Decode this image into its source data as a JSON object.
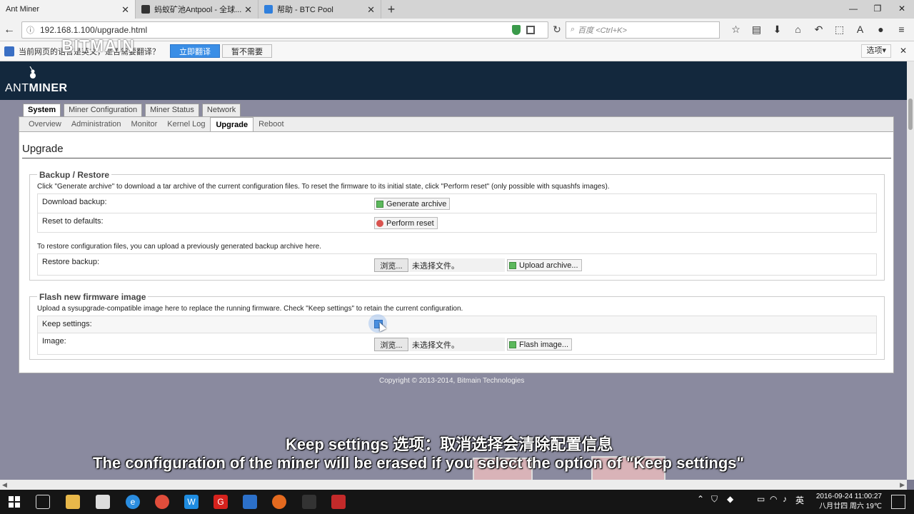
{
  "browser": {
    "tabs": [
      {
        "title": "Ant Miner",
        "active": true,
        "icon": "page-icon"
      },
      {
        "title": "蚂蚁矿池Antpool - 全球...",
        "active": false,
        "icon": "antpool-icon"
      },
      {
        "title": "帮助 - BTC Pool",
        "active": false,
        "icon": "btcpool-icon"
      }
    ],
    "new_tab": "+",
    "window_controls": [
      "—",
      "❐",
      "✕"
    ],
    "url": "192.168.1.100/upgrade.html",
    "search_placeholder": "百度 <Ctrl+K>",
    "translate_bar": {
      "prompt": "当前网页的语言是英文，是否需要翻译？",
      "translate_button": "立即翻译",
      "no_need_button": "暂不需要",
      "options": "选项▾",
      "close": "✕"
    }
  },
  "overlay_watermark": "BITMAIN",
  "app": {
    "logo_prefix": "ANT",
    "logo_suffix": "MINER",
    "main_tabs": [
      "System",
      "Miner Configuration",
      "Miner Status",
      "Network"
    ],
    "active_main_tab": "System",
    "sub_tabs": [
      "Overview",
      "Administration",
      "Monitor",
      "Kernel Log",
      "Upgrade",
      "Reboot"
    ],
    "active_sub_tab": "Upgrade",
    "page_title": "Upgrade",
    "backup": {
      "legend": "Backup / Restore",
      "description": "Click \"Generate archive\" to download a tar archive of the current configuration files. To reset the firmware to its initial state, click \"Perform reset\" (only possible with squashfs images).",
      "download_label": "Download backup:",
      "generate_button": "Generate archive",
      "reset_label": "Reset to defaults:",
      "reset_button": "Perform reset",
      "restore_description": "To restore configuration files, you can upload a previously generated backup archive here.",
      "restore_label": "Restore backup:",
      "browse_button": "浏览...",
      "no_file": "未选择文件。",
      "upload_button": "Upload archive..."
    },
    "flash": {
      "legend": "Flash new firmware image",
      "description": "Upload a sysupgrade-compatible image here to replace the running firmware. Check \"Keep settings\" to retain the current configuration.",
      "keep_label": "Keep settings:",
      "keep_checked": true,
      "image_label": "Image:",
      "browse_button": "浏览...",
      "no_file": "未选择文件。",
      "flash_button": "Flash image..."
    },
    "copyright": "Copyright © 2013-2014, Bitmain Technologies"
  },
  "subtitles": {
    "chinese": "Keep settings  选项：取消选择会清除配置信息",
    "english": "The configuration of the miner will be erased if you select the option of \"Keep settings\""
  },
  "taskbar": {
    "time": "2016-09-24  11:00:27",
    "date_line": "八月廿四 周六 19℃",
    "ime": "英"
  },
  "colors": {
    "header_bg": "#13283d",
    "page_bg": "#8a8a9f",
    "translate_button": "#3a8ee6",
    "taskbar": "#151515"
  }
}
